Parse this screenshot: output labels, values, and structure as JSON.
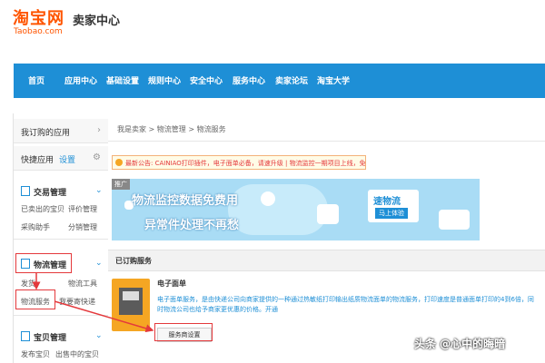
{
  "header": {
    "logo_cn": "淘宝网",
    "logo_en": "Taobao.com",
    "title": "卖家中心"
  },
  "topnav": {
    "items": [
      "首页",
      "应用中心",
      "基础设置",
      "规则中心",
      "安全中心",
      "服务中心",
      "卖家论坛",
      "淘宝大学"
    ]
  },
  "sidebar": {
    "my_apps": "我订购的应用",
    "quick_apps": "快捷应用",
    "quick_apps_tag": "设置",
    "groups": [
      {
        "title": "交易管理",
        "items": [
          "已卖出的宝贝",
          "评价管理",
          "采购助手",
          "分销管理"
        ]
      },
      {
        "title": "物流管理",
        "items": [
          "发货",
          "物流工具",
          "物流服务",
          "我要寄快递"
        ]
      },
      {
        "title": "宝贝管理",
        "items": [
          "发布宝贝",
          "出售中的宝贝"
        ]
      }
    ]
  },
  "main": {
    "breadcrumb": "我是卖家 > 物流管理 > 物流服务",
    "notice": "最新公告: CAINIAO打印插件，电子面单必备，请速升级 | 物流监控一期项目上线，免费用！",
    "banner": {
      "ad_tag": "推广",
      "line1": "物流监控数据免费用",
      "line2": "异常件处理不再愁",
      "brand": "速物流",
      "brand_btn": "马上体验"
    },
    "section_title": "已订购服务",
    "service": {
      "title": "电子面单",
      "description": "电子面单服务，是由快递公司向商家提供的一种通过热敏纸打印输出纸质物流面单的物流服务，打印速度是普通面单打印的4到6倍，同时物流公司也给予商家更优惠的价格。开通",
      "button": "服务商设置"
    }
  },
  "watermark": "头条 @心中的晦暗",
  "colors": {
    "brand": "#ff5500",
    "nav": "#1e8fd6",
    "highlight": "#e4393c"
  }
}
